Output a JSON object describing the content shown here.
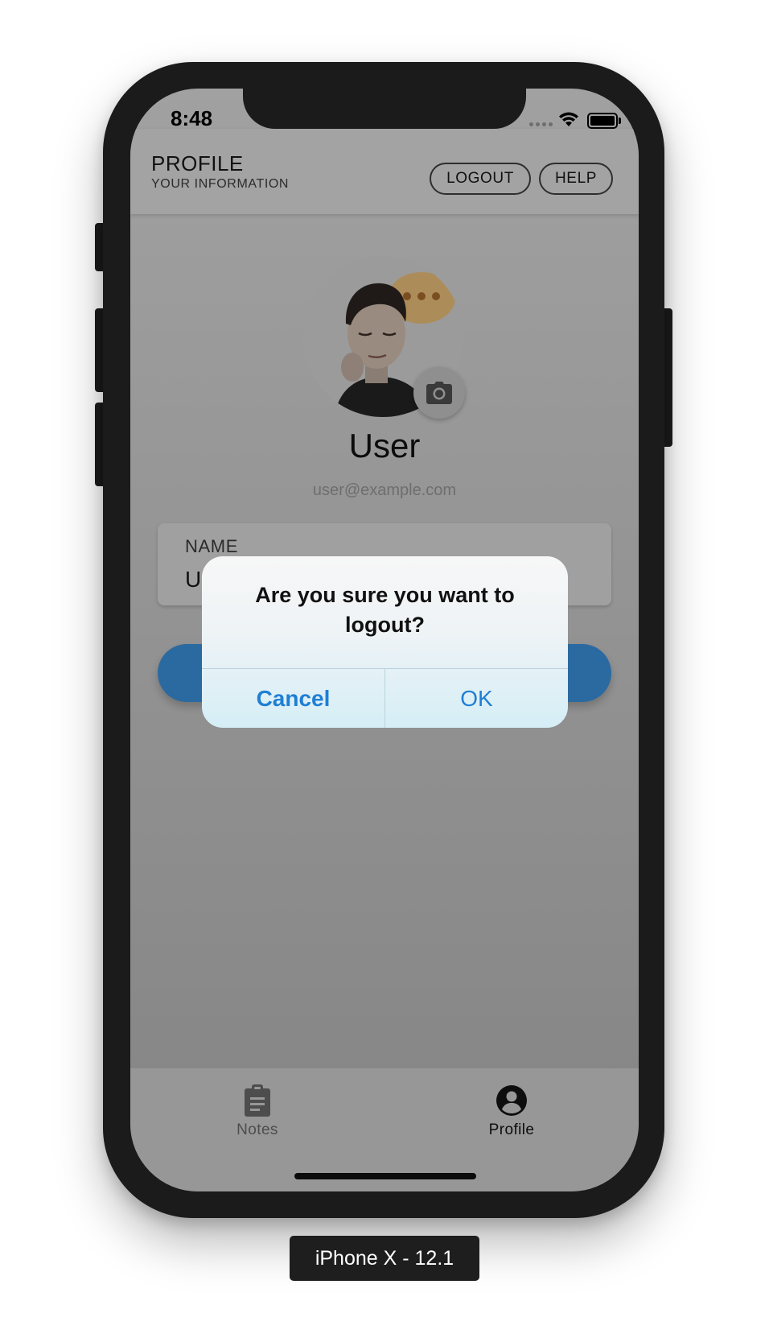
{
  "status_bar": {
    "time": "8:48"
  },
  "header": {
    "title": "PROFILE",
    "subtitle": "YOUR INFORMATION",
    "logout_label": "LOGOUT",
    "help_label": "HELP"
  },
  "profile": {
    "name": "User",
    "email": "user@example.com",
    "name_field_label": "NAME",
    "name_field_value": "U"
  },
  "alert": {
    "message": "Are you sure you want to logout?",
    "cancel_label": "Cancel",
    "ok_label": "OK"
  },
  "tabs": [
    {
      "label": "Notes",
      "icon": "clipboard-icon",
      "active": false
    },
    {
      "label": "Profile",
      "icon": "account-circle-icon",
      "active": true
    }
  ],
  "device_caption": "iPhone X - 12.1",
  "colors": {
    "alert_button_text": "#1f7fd3",
    "primary_button": "#2b6aa0",
    "screen_overlay": "#9a9a9a"
  }
}
